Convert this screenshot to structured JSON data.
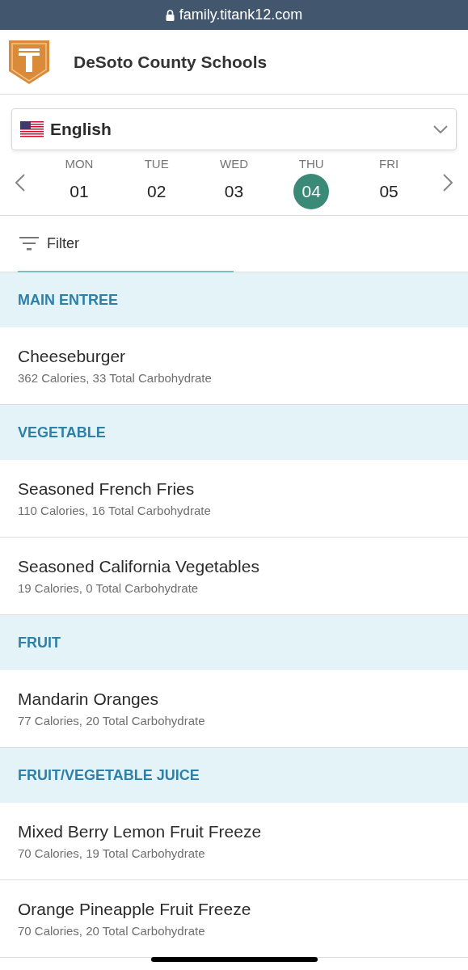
{
  "browser_bar": {
    "url": "family.titank12.com"
  },
  "header": {
    "title": "DeSoto County Schools"
  },
  "language": {
    "value": "English"
  },
  "days": [
    {
      "weekday": "MON",
      "date": "01",
      "selected": false
    },
    {
      "weekday": "TUE",
      "date": "02",
      "selected": false
    },
    {
      "weekday": "WED",
      "date": "03",
      "selected": false
    },
    {
      "weekday": "THU",
      "date": "04",
      "selected": true
    },
    {
      "weekday": "FRI",
      "date": "05",
      "selected": false
    }
  ],
  "filter": {
    "label": "Filter"
  },
  "sections": [
    {
      "title": "MAIN ENTREE",
      "items": [
        {
          "name": "Cheeseburger",
          "details": "362 Calories, 33 Total Carbohydrate"
        }
      ]
    },
    {
      "title": "VEGETABLE",
      "items": [
        {
          "name": "Seasoned French Fries",
          "details": "110 Calories, 16 Total Carbohydrate"
        },
        {
          "name": "Seasoned California Vegetables",
          "details": "19 Calories, 0 Total Carbohydrate"
        }
      ]
    },
    {
      "title": "FRUIT",
      "items": [
        {
          "name": "Mandarin Oranges",
          "details": "77 Calories, 20 Total Carbohydrate"
        }
      ]
    },
    {
      "title": "FRUIT/VEGETABLE JUICE",
      "items": [
        {
          "name": "Mixed Berry Lemon Fruit Freeze",
          "details": "70 Calories, 19 Total Carbohydrate"
        },
        {
          "name": "Orange Pineapple Fruit Freeze",
          "details": "70 Calories, 20 Total Carbohydrate"
        }
      ]
    }
  ]
}
